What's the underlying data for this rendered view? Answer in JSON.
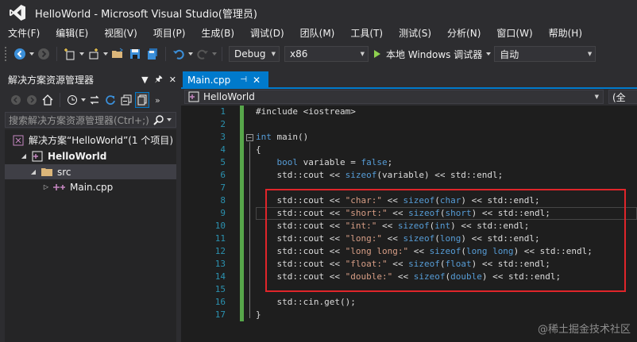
{
  "window": {
    "title": "HelloWorld - Microsoft Visual Studio(管理员)"
  },
  "menu": [
    "文件(F)",
    "编辑(E)",
    "视图(V)",
    "项目(P)",
    "生成(B)",
    "调试(D)",
    "团队(M)",
    "工具(T)",
    "测试(S)",
    "分析(N)",
    "窗口(W)",
    "帮助(H)"
  ],
  "toolbar": {
    "config": "Debug",
    "platform": "x86",
    "run_label": "本地 Windows 调试器",
    "mode": "自动"
  },
  "solution_explorer": {
    "title": "解决方案资源管理器",
    "search_placeholder": "搜索解决方案资源管理器(Ctrl+;)",
    "tree": [
      {
        "label": "解决方案“HelloWorld”(1 个项目)"
      },
      {
        "label": "HelloWorld"
      },
      {
        "label": "src"
      },
      {
        "label": "Main.cpp"
      }
    ]
  },
  "editor": {
    "tab_label": "Main.cpp",
    "scope_label": "HelloWorld",
    "member_label": "(全",
    "lines": [
      {
        "num": "1",
        "html": "#include &lt;iostream&gt;"
      },
      {
        "num": "2",
        "html": ""
      },
      {
        "num": "3",
        "html": "<span class=\"kw\">int</span> main()"
      },
      {
        "num": "4",
        "html": "{"
      },
      {
        "num": "5",
        "html": "    <span class=\"kw\">bool</span> variable = <span class=\"kw\">false</span>;"
      },
      {
        "num": "6",
        "html": "    std::cout &lt;&lt; <span class=\"kw\">sizeof</span>(variable) &lt;&lt; std::endl;"
      },
      {
        "num": "7",
        "html": ""
      },
      {
        "num": "8",
        "html": "    std::cout &lt;&lt; <span class=\"str\">\"char:\"</span> &lt;&lt; <span class=\"kw\">sizeof</span>(<span class=\"kw\">char</span>) &lt;&lt; std::endl;"
      },
      {
        "num": "9",
        "html": "    std::cout &lt;&lt; <span class=\"str\">\"short:\"</span> &lt;&lt; <span class=\"kw\">sizeof</span>(<span class=\"kw\">short</span>) &lt;&lt; std::endl;"
      },
      {
        "num": "10",
        "html": "    std::cout &lt;&lt; <span class=\"str\">\"int:\"</span> &lt;&lt; <span class=\"kw\">sizeof</span>(<span class=\"kw\">int</span>) &lt;&lt; std::endl;"
      },
      {
        "num": "11",
        "html": "    std::cout &lt;&lt; <span class=\"str\">\"long:\"</span> &lt;&lt; <span class=\"kw\">sizeof</span>(<span class=\"kw\">long</span>) &lt;&lt; std::endl;"
      },
      {
        "num": "12",
        "html": "    std::cout &lt;&lt; <span class=\"str\">\"long long:\"</span> &lt;&lt; <span class=\"kw\">sizeof</span>(<span class=\"kw\">long long</span>) &lt;&lt; std::endl;"
      },
      {
        "num": "13",
        "html": "    std::cout &lt;&lt; <span class=\"str\">\"float:\"</span> &lt;&lt; <span class=\"kw\">sizeof</span>(<span class=\"kw\">float</span>) &lt;&lt; std::endl;"
      },
      {
        "num": "14",
        "html": "    std::cout &lt;&lt; <span class=\"str\">\"double:\"</span> &lt;&lt; <span class=\"kw\">sizeof</span>(<span class=\"kw\">double</span>) &lt;&lt; std::endl;"
      },
      {
        "num": "15",
        "html": ""
      },
      {
        "num": "16",
        "html": "    std::cin.get();"
      },
      {
        "num": "17",
        "html": "}"
      }
    ]
  },
  "watermark": "@稀土掘金技术社区",
  "colors": {
    "accent": "#007acc",
    "keyword": "#569cd6",
    "string": "#d69d85",
    "line_number": "#2b91af",
    "change_bar": "#57a64a",
    "highlight_box": "#e0252a"
  }
}
